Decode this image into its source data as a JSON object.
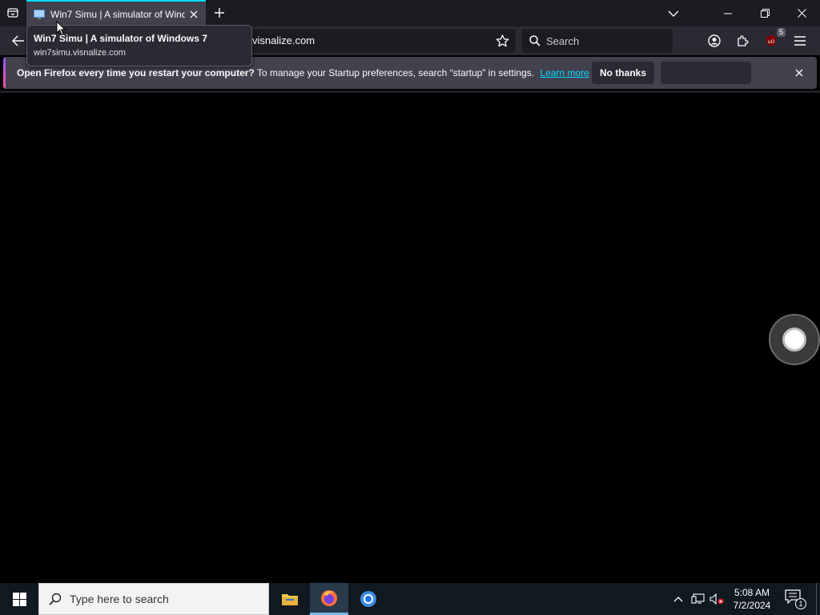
{
  "tab": {
    "title": "Win7 Simu | A simulator of Windows 7",
    "close_icon": "close-icon"
  },
  "tooltip": {
    "title": "Win7 Simu | A simulator of Windows 7",
    "url": "win7simu.visnalize.com"
  },
  "urlbar": {
    "visible_url": "visnalize.com"
  },
  "searchbar": {
    "placeholder": "Search"
  },
  "toolbar": {
    "ublock_badge": "5"
  },
  "notification": {
    "bold_text": "Open Firefox every time you restart your computer?",
    "text": "To manage your Startup preferences, search “startup” in settings.",
    "learn_more": "Learn more",
    "no_thanks": "No thanks",
    "primary_label": ""
  },
  "taskbar": {
    "search_placeholder": "Type here to search",
    "time": "5:08 AM",
    "date": "7/2/2024",
    "notification_count": "1"
  },
  "colors": {
    "tab_accent": "#00ddff",
    "link": "#00ddff",
    "chrome_bg": "#1c1b22",
    "taskbar_bg": "#101820"
  }
}
